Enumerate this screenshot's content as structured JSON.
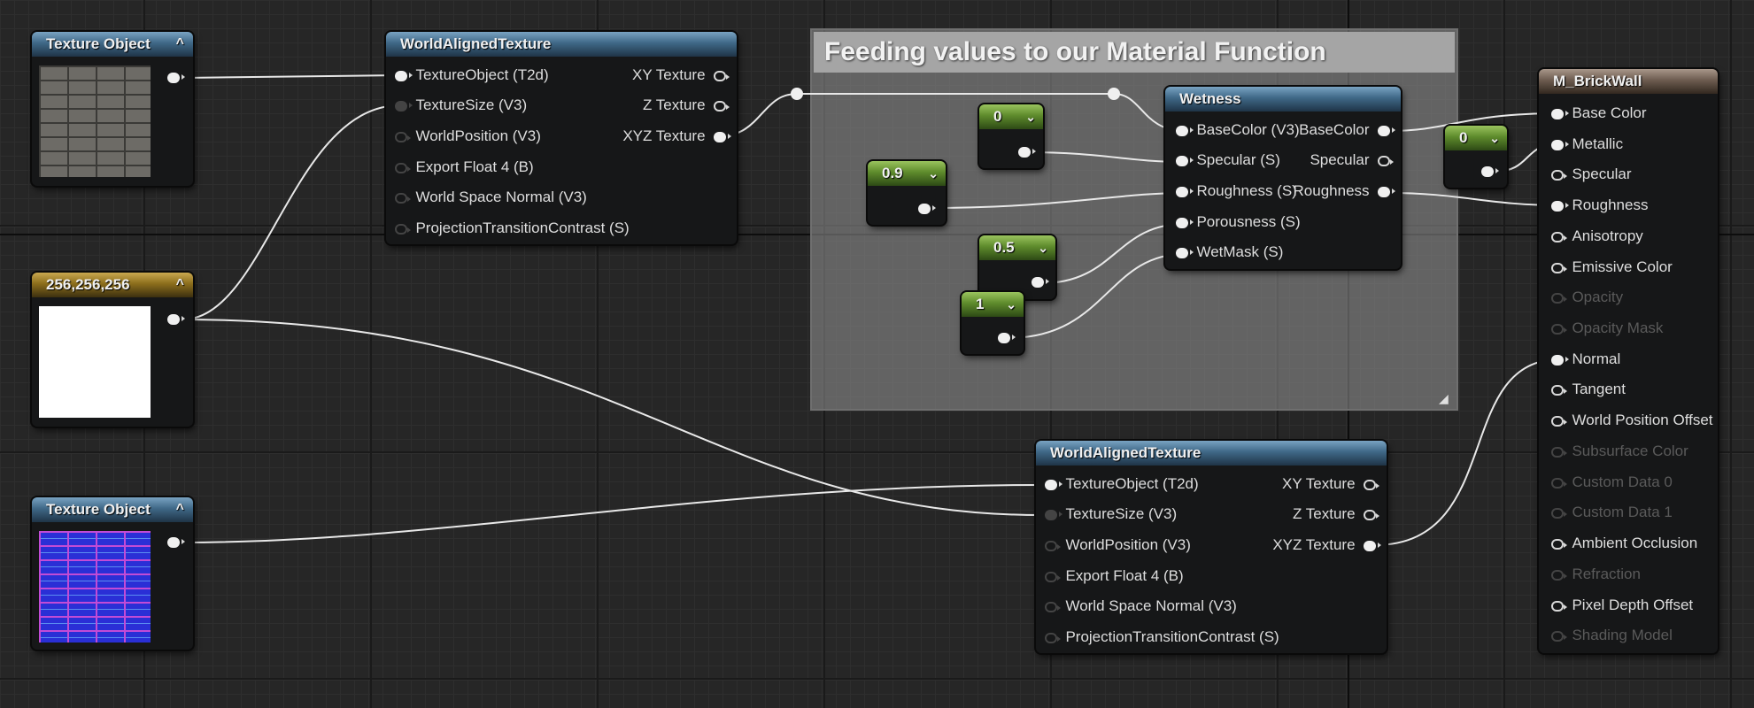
{
  "comment": {
    "title": "Feeding values to our Material Function"
  },
  "texture_object_1": {
    "title": "Texture Object",
    "collapse": "^"
  },
  "vector_node": {
    "title": "256,256,256",
    "collapse": "^"
  },
  "texture_object_2": {
    "title": "Texture Object",
    "collapse": "^"
  },
  "wat_top": {
    "title": "WorldAlignedTexture",
    "inputs": [
      "TextureObject (T2d)",
      "TextureSize (V3)",
      "WorldPosition (V3)",
      "Export Float 4 (B)",
      "World Space Normal (V3)",
      "ProjectionTransitionContrast (S)"
    ],
    "outputs": [
      "XY Texture",
      "Z Texture",
      "XYZ Texture"
    ]
  },
  "wat_bottom": {
    "title": "WorldAlignedTexture",
    "inputs": [
      "TextureObject (T2d)",
      "TextureSize (V3)",
      "WorldPosition (V3)",
      "Export Float 4 (B)",
      "World Space Normal (V3)",
      "ProjectionTransitionContrast (S)"
    ],
    "outputs": [
      "XY Texture",
      "Z Texture",
      "XYZ Texture"
    ]
  },
  "const_nodes": {
    "c0": "0",
    "c09": "0.9",
    "c05": "0.5",
    "c1": "1",
    "metal0": "0",
    "chevron": "⌄"
  },
  "wetness": {
    "title": "Wetness",
    "inputs": [
      "BaseColor (V3)",
      "Specular (S)",
      "Roughness (S)",
      "Porousness (S)",
      "WetMask (S)"
    ],
    "outputs": [
      "BaseColor",
      "Specular",
      "Roughness"
    ]
  },
  "material": {
    "title": "M_BrickWall",
    "pins": [
      "Base Color",
      "Metallic",
      "Specular",
      "Roughness",
      "Anisotropy",
      "Emissive Color",
      "Opacity",
      "Opacity Mask",
      "Normal",
      "Tangent",
      "World Position Offset",
      "Subsurface Color",
      "Custom Data 0",
      "Custom Data 1",
      "Ambient Occlusion",
      "Refraction",
      "Pixel Depth Offset",
      "Shading Model"
    ]
  },
  "colors": {
    "background": "#262626",
    "header_blue": "#3f6887",
    "header_gold": "#8c6e1c",
    "header_green": "#5e8b2c",
    "header_brown": "#6d5c50"
  }
}
